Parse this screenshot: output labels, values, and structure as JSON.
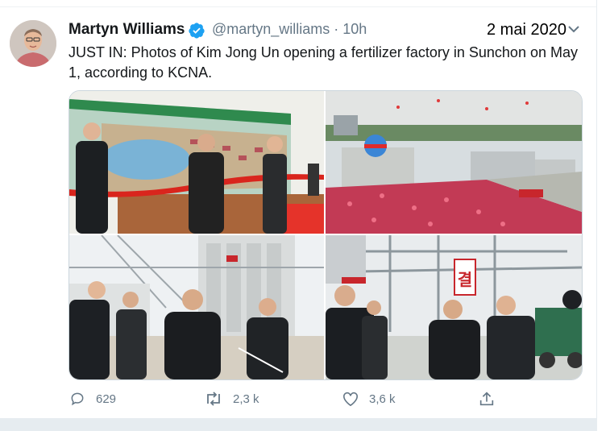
{
  "tweet": {
    "author_name": "Martyn Williams",
    "handle_time": "@martyn_williams · 10h",
    "overlay_date": "2 mai 2020",
    "text": "JUST IN: Photos of Kim Jong Un opening a fertilizer factory in Sunchon on May 1, according to KCNA.",
    "photos": {
      "p2_sign": "결"
    },
    "actions": {
      "reply_count": "629",
      "retweet_count": "2,3 k",
      "like_count": "3,6 k"
    }
  },
  "icons": [
    "verified-badge-icon",
    "chevron-down-icon",
    "reply-icon",
    "retweet-icon",
    "like-icon",
    "share-icon"
  ],
  "colors": {
    "accent": "#1da1f2",
    "secondary_text": "#657786",
    "ribbon": "#d9251d"
  }
}
